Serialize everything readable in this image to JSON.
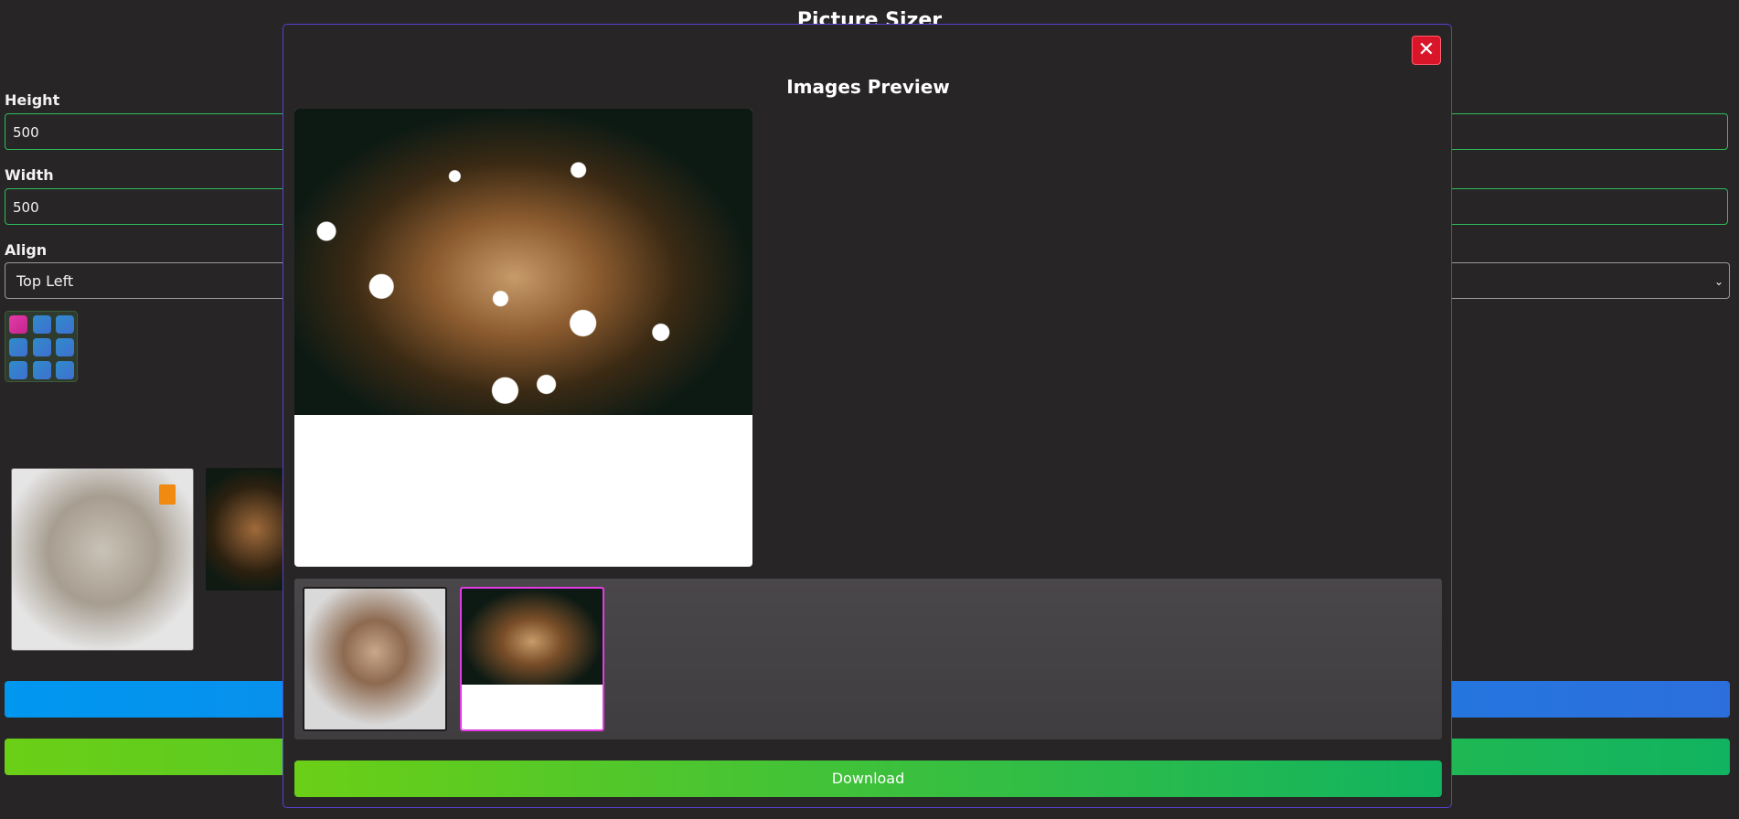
{
  "app": {
    "title": "Picture Sizer"
  },
  "form": {
    "height": {
      "label": "Height",
      "value": "500"
    },
    "width": {
      "label": "Width",
      "value": "500"
    },
    "align": {
      "label": "Align",
      "value": "Top Left"
    }
  },
  "modal": {
    "title": "Images Preview",
    "close_icon": "close-icon",
    "download_label": "Download",
    "thumbnails": [
      {
        "name": "curly-face-artwork"
      },
      {
        "name": "woman-with-lights",
        "selected": true
      }
    ]
  },
  "colors": {
    "modal_border": "#5a3fd1",
    "close_button": "#d9152a",
    "selected_thumb_border": "#e33ae6",
    "download_start": "#6bcf16",
    "download_end": "#11b360"
  }
}
